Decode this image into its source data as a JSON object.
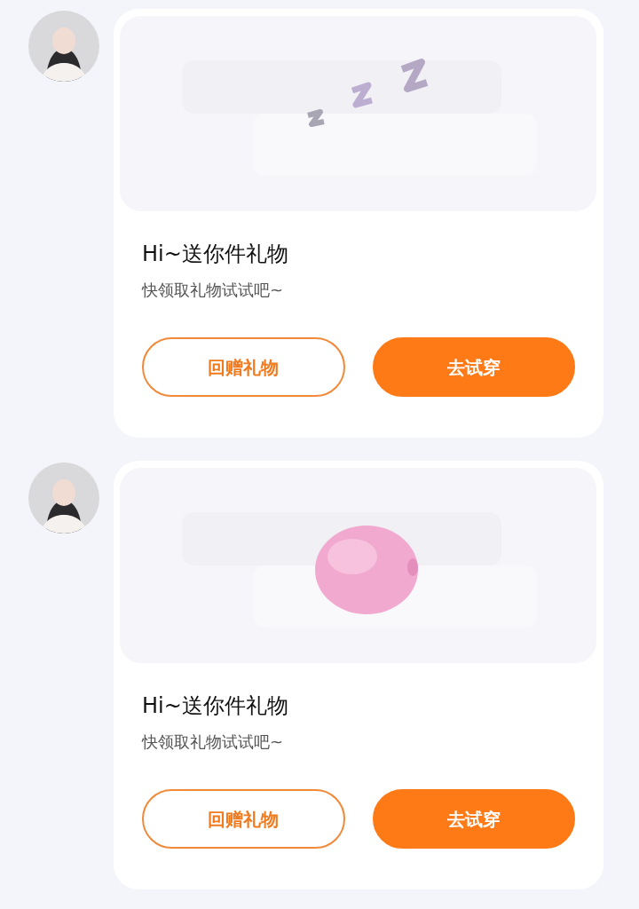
{
  "messages": [
    {
      "title": "Hi~送你件礼物",
      "subtitle": "快领取礼物试试吧~",
      "buttons": [
        {
          "kind": "outline",
          "label": "回赠礼物"
        },
        {
          "kind": "filled",
          "label": "去试穿"
        }
      ]
    },
    {
      "title": "Hi~送你件礼物",
      "subtitle": "快领取礼物试试吧~",
      "buttons": [
        {
          "kind": "outline",
          "label": "回赠礼物"
        },
        {
          "kind": "filled",
          "label": "去试穿"
        }
      ]
    }
  ]
}
